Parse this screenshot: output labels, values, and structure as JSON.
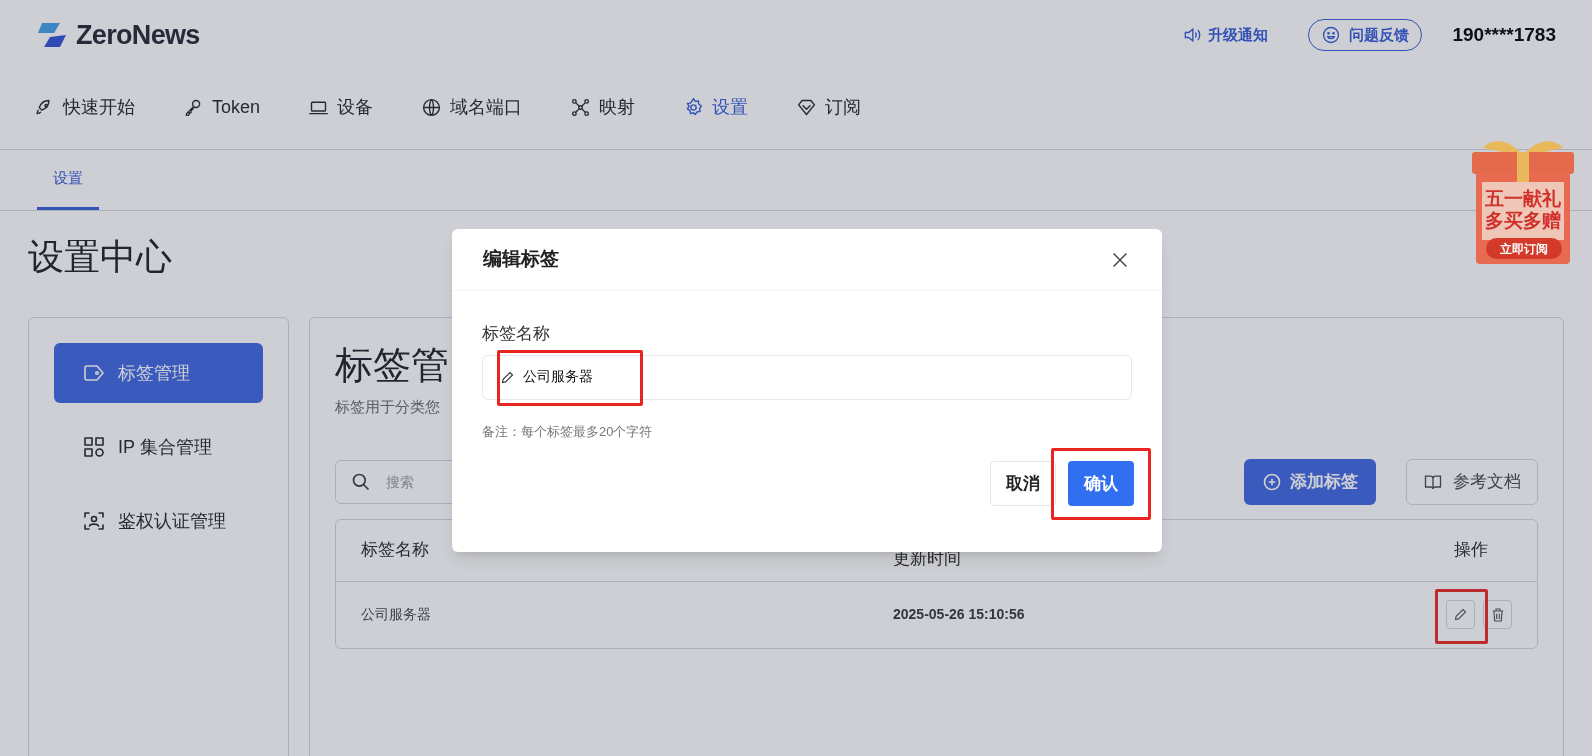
{
  "header": {
    "brand": "ZeroNews",
    "upgrade_notice": "升级通知",
    "feedback": "问题反馈",
    "account": "190****1783"
  },
  "nav": [
    {
      "label": "快速开始",
      "selected": false
    },
    {
      "label": "Token",
      "selected": false
    },
    {
      "label": "设备",
      "selected": false
    },
    {
      "label": "域名端口",
      "selected": false
    },
    {
      "label": "映射",
      "selected": false
    },
    {
      "label": "设置",
      "selected": true
    },
    {
      "label": "订阅",
      "selected": false
    }
  ],
  "subtabs": [
    {
      "label": "设置",
      "selected": true
    }
  ],
  "promo": {
    "line_1": "五一献礼",
    "line_2": "多买多赠",
    "action": "立即订阅"
  },
  "page_title": "设置中心",
  "sidebar": {
    "items": [
      {
        "label": "标签管理",
        "selected": true
      },
      {
        "label": "IP 集合管理",
        "selected": false
      },
      {
        "label": "鉴权认证管理",
        "selected": false
      }
    ]
  },
  "content": {
    "title": "标签管",
    "subtitle": "标签用于分类您",
    "search": {
      "placeholder": "搜索"
    },
    "add_button": "添加标签",
    "docs_button": "参考文档",
    "table": {
      "columns": [
        "标签名称",
        "更新时间",
        "操作"
      ],
      "rows": [
        {
          "name": "公司服务器",
          "updated": "2025-05-26 15:10:56",
          "edit_highlighted": true
        }
      ]
    }
  },
  "dialog": {
    "title": "编辑标签",
    "field_label": "标签名称",
    "field_value": "公司服务器",
    "field_highlighted": true,
    "note": "备注：每个标签最多20个字符",
    "cancel": "取消",
    "confirm": "确认",
    "confirm_highlighted": true
  }
}
